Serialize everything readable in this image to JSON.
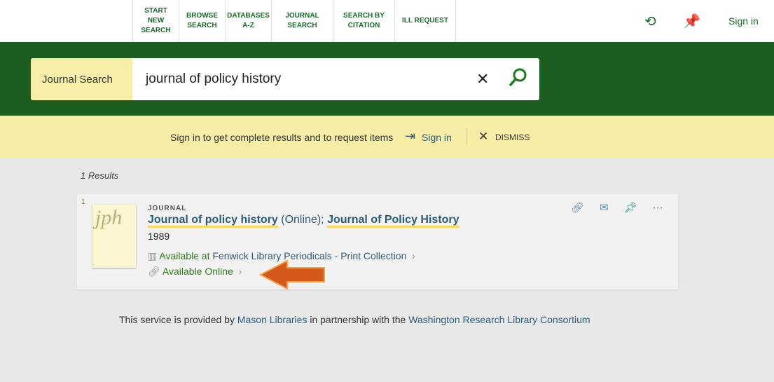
{
  "nav": {
    "items": [
      "START NEW SEARCH",
      "BROWSE SEARCH",
      "DATABASES A-Z",
      "JOURNAL SEARCH",
      "SEARCH BY CITATION",
      "ILL REQUEST"
    ],
    "sign_in": "Sign in"
  },
  "search": {
    "scope": "Journal Search",
    "query": "journal of policy history"
  },
  "notice": {
    "text": "Sign in to get complete results and to request items",
    "sign_in": "Sign in",
    "dismiss": "DISMISS"
  },
  "results": {
    "count": "1 Results",
    "items": [
      {
        "index": "1",
        "type": "JOURNAL",
        "title_a": "Journal of policy history",
        "title_mid": " (Online); ",
        "title_b": "Journal of Policy History",
        "year": "1989",
        "cover_text": "jph",
        "avail1_status": "Available at ",
        "avail1_location": "Fenwick Library  Periodicals - Print Collection",
        "avail2": "Available Online"
      }
    ]
  },
  "footer": {
    "pre": "This service is provided by ",
    "link1": "Mason Libraries",
    "mid": " in partnership with the ",
    "link2": "Washington Research Library Consortium"
  }
}
